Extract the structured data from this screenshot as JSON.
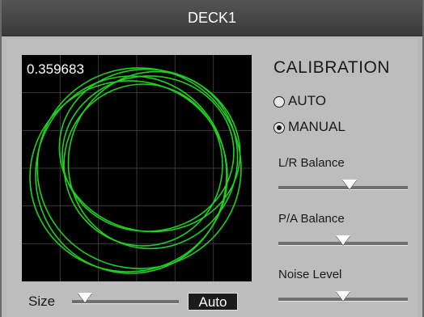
{
  "window": {
    "title": "DECK1"
  },
  "scope": {
    "value": "0.359683",
    "trace_color": "#1fd11f",
    "grid_color": "#3a3a3a"
  },
  "size_control": {
    "label": "Size",
    "level": 0.12,
    "auto_label": "Auto"
  },
  "calibration": {
    "title": "CALIBRATION",
    "modes": [
      {
        "label": "AUTO",
        "selected": false
      },
      {
        "label": "MANUAL",
        "selected": true
      }
    ],
    "sliders": [
      {
        "label": "L/R Balance",
        "level": 0.55
      },
      {
        "label": "P/A Balance",
        "level": 0.5
      },
      {
        "label": "Noise Level",
        "level": 0.5
      }
    ]
  }
}
